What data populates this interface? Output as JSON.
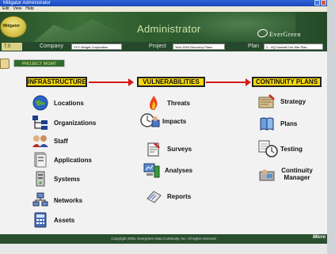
{
  "window": {
    "title": "Mitigator Administrator"
  },
  "menu": {
    "items": [
      "Edit",
      "View",
      "Help"
    ]
  },
  "banner": {
    "admin_title": "Administrator",
    "logo_text": "Mitigator",
    "brand": "EverGreen"
  },
  "info": {
    "version": "7.0",
    "company_label": "Company",
    "company_value": "XYZ Widget Corporation",
    "project_label": "Project",
    "project_value": "Year 2004 Recovery Plans",
    "plan_label": "Plan",
    "plan_value": "1 - HQ Dunwell Hot Site Plan"
  },
  "project_mgmt_label": "PROJECT MGMT",
  "columns": {
    "infrastructure": {
      "heading": "INFRASTRUCTURE",
      "items": [
        {
          "label": "Locations",
          "icon": "globe-icon"
        },
        {
          "label": "Organizations",
          "icon": "org-chart-icon"
        },
        {
          "label": "Staff",
          "icon": "staff-icon"
        },
        {
          "label": "Applications",
          "icon": "applications-icon"
        },
        {
          "label": "Systems",
          "icon": "server-icon"
        },
        {
          "label": "Networks",
          "icon": "network-icon"
        },
        {
          "label": "Assets",
          "icon": "calculator-icon"
        }
      ]
    },
    "vulnerabilities": {
      "heading": "VULNERABILITIES",
      "items": [
        {
          "label": "Threats",
          "icon": "fire-icon"
        },
        {
          "label": "Impacts",
          "icon": "clock-icon"
        },
        {
          "label": "Surveys",
          "icon": "survey-icon"
        },
        {
          "label": "Analyses",
          "icon": "analyses-icon"
        },
        {
          "label": "Reports",
          "icon": "reports-icon"
        }
      ]
    },
    "continuity": {
      "heading": "CONTINUITY PLANS",
      "items": [
        {
          "label": "Strategy",
          "icon": "strategy-icon"
        },
        {
          "label": "Plans",
          "icon": "book-icon"
        },
        {
          "label": "Testing",
          "icon": "stopwatch-icon"
        },
        {
          "label": "Continuity Manager",
          "icon": "manager-icon"
        }
      ]
    }
  },
  "footer": {
    "copyright": "Copyright 2005, Evergreen Data Continuity, Inc.  All rights reserved",
    "vendor": "Micro"
  },
  "colors": {
    "heading_bg": "#f7d90a",
    "arrow": "#d81818",
    "banner_green": "#2f5c2e"
  }
}
